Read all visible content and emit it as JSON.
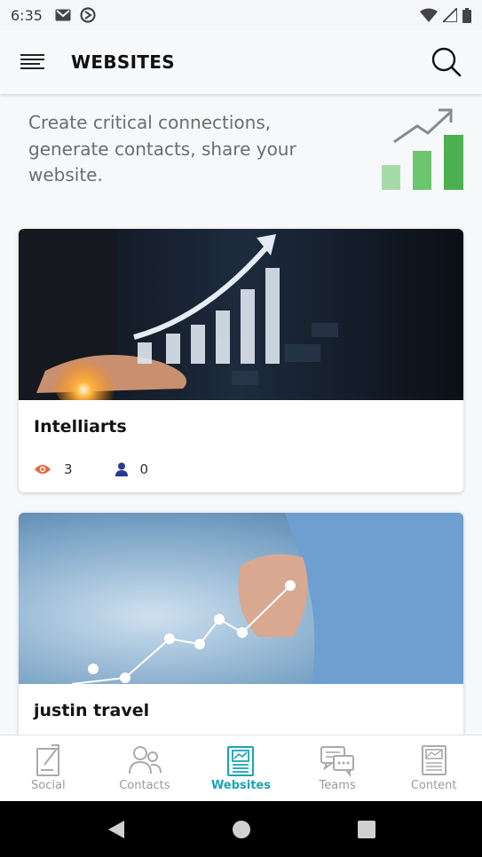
{
  "status_bar": {
    "time": "6:35"
  },
  "app_bar": {
    "title": "WEBSITES"
  },
  "intro": {
    "text": "Create critical connections, generate contacts, share your website."
  },
  "websites": [
    {
      "name": "Intelliarts",
      "views": "3",
      "contacts": "0"
    },
    {
      "name": "justin travel"
    }
  ],
  "bottom_nav": {
    "items": [
      {
        "label": "Social",
        "icon": "social-icon"
      },
      {
        "label": "Contacts",
        "icon": "contacts-icon"
      },
      {
        "label": "Websites",
        "icon": "websites-icon"
      },
      {
        "label": "Teams",
        "icon": "teams-icon"
      },
      {
        "label": "Content",
        "icon": "content-icon"
      }
    ],
    "active": "Websites"
  },
  "colors": {
    "accent": "#1aa3b5",
    "views_icon": "#e8663c",
    "contacts_icon": "#2a3b8f",
    "growth_green": "#4caf50"
  }
}
